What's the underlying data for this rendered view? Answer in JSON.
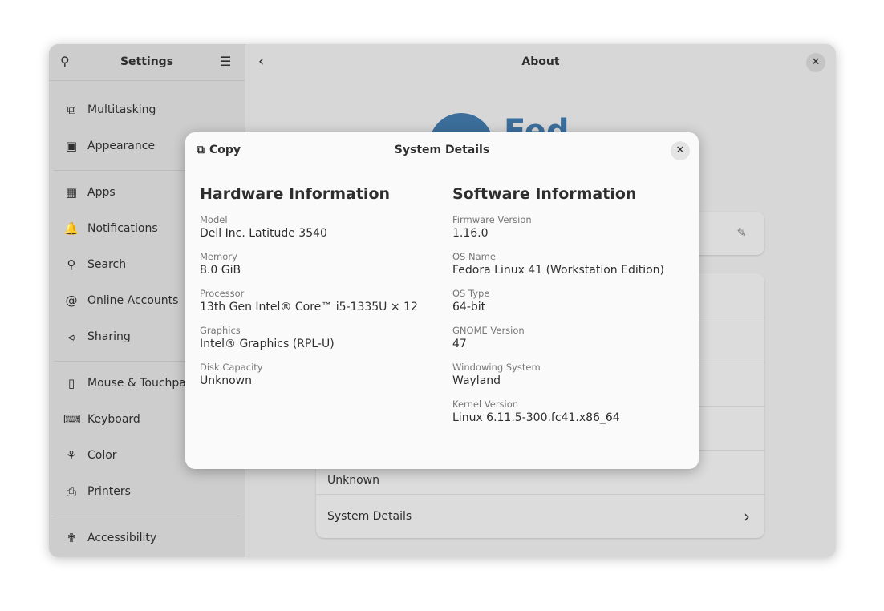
{
  "sidebar": {
    "title": "Settings",
    "items": [
      {
        "label": "Multitasking",
        "icon": "multitasking-icon"
      },
      {
        "label": "Appearance",
        "icon": "appearance-icon"
      },
      {
        "label": "Apps",
        "icon": "apps-icon"
      },
      {
        "label": "Notifications",
        "icon": "bell-icon"
      },
      {
        "label": "Search",
        "icon": "search-icon"
      },
      {
        "label": "Online Accounts",
        "icon": "at-icon"
      },
      {
        "label": "Sharing",
        "icon": "share-icon"
      },
      {
        "label": "Mouse & Touchpad",
        "icon": "mouse-icon"
      },
      {
        "label": "Keyboard",
        "icon": "keyboard-icon"
      },
      {
        "label": "Color",
        "icon": "color-icon"
      },
      {
        "label": "Printers",
        "icon": "printer-icon"
      },
      {
        "label": "Accessibility",
        "icon": "accessibility-icon"
      }
    ]
  },
  "main": {
    "title": "About",
    "logo_text": "Fed",
    "disk_value": "Unknown",
    "system_details": "System Details"
  },
  "dialog": {
    "title": "System Details",
    "copy": "Copy",
    "hardware": {
      "heading": "Hardware Information",
      "fields": [
        {
          "label": "Model",
          "value": "Dell Inc. Latitude 3540"
        },
        {
          "label": "Memory",
          "value": "8.0 GiB"
        },
        {
          "label": "Processor",
          "value": "13th Gen Intel® Core™ i5-1335U × 12"
        },
        {
          "label": "Graphics",
          "value": "Intel® Graphics (RPL-U)"
        },
        {
          "label": "Disk Capacity",
          "value": "Unknown"
        }
      ]
    },
    "software": {
      "heading": "Software Information",
      "fields": [
        {
          "label": "Firmware Version",
          "value": "1.16.0"
        },
        {
          "label": "OS Name",
          "value": "Fedora Linux 41 (Workstation Edition)"
        },
        {
          "label": "OS Type",
          "value": "64-bit"
        },
        {
          "label": "GNOME Version",
          "value": "47"
        },
        {
          "label": "Windowing System",
          "value": "Wayland"
        },
        {
          "label": "Kernel Version",
          "value": "Linux 6.11.5-300.fc41.x86_64"
        }
      ]
    }
  }
}
